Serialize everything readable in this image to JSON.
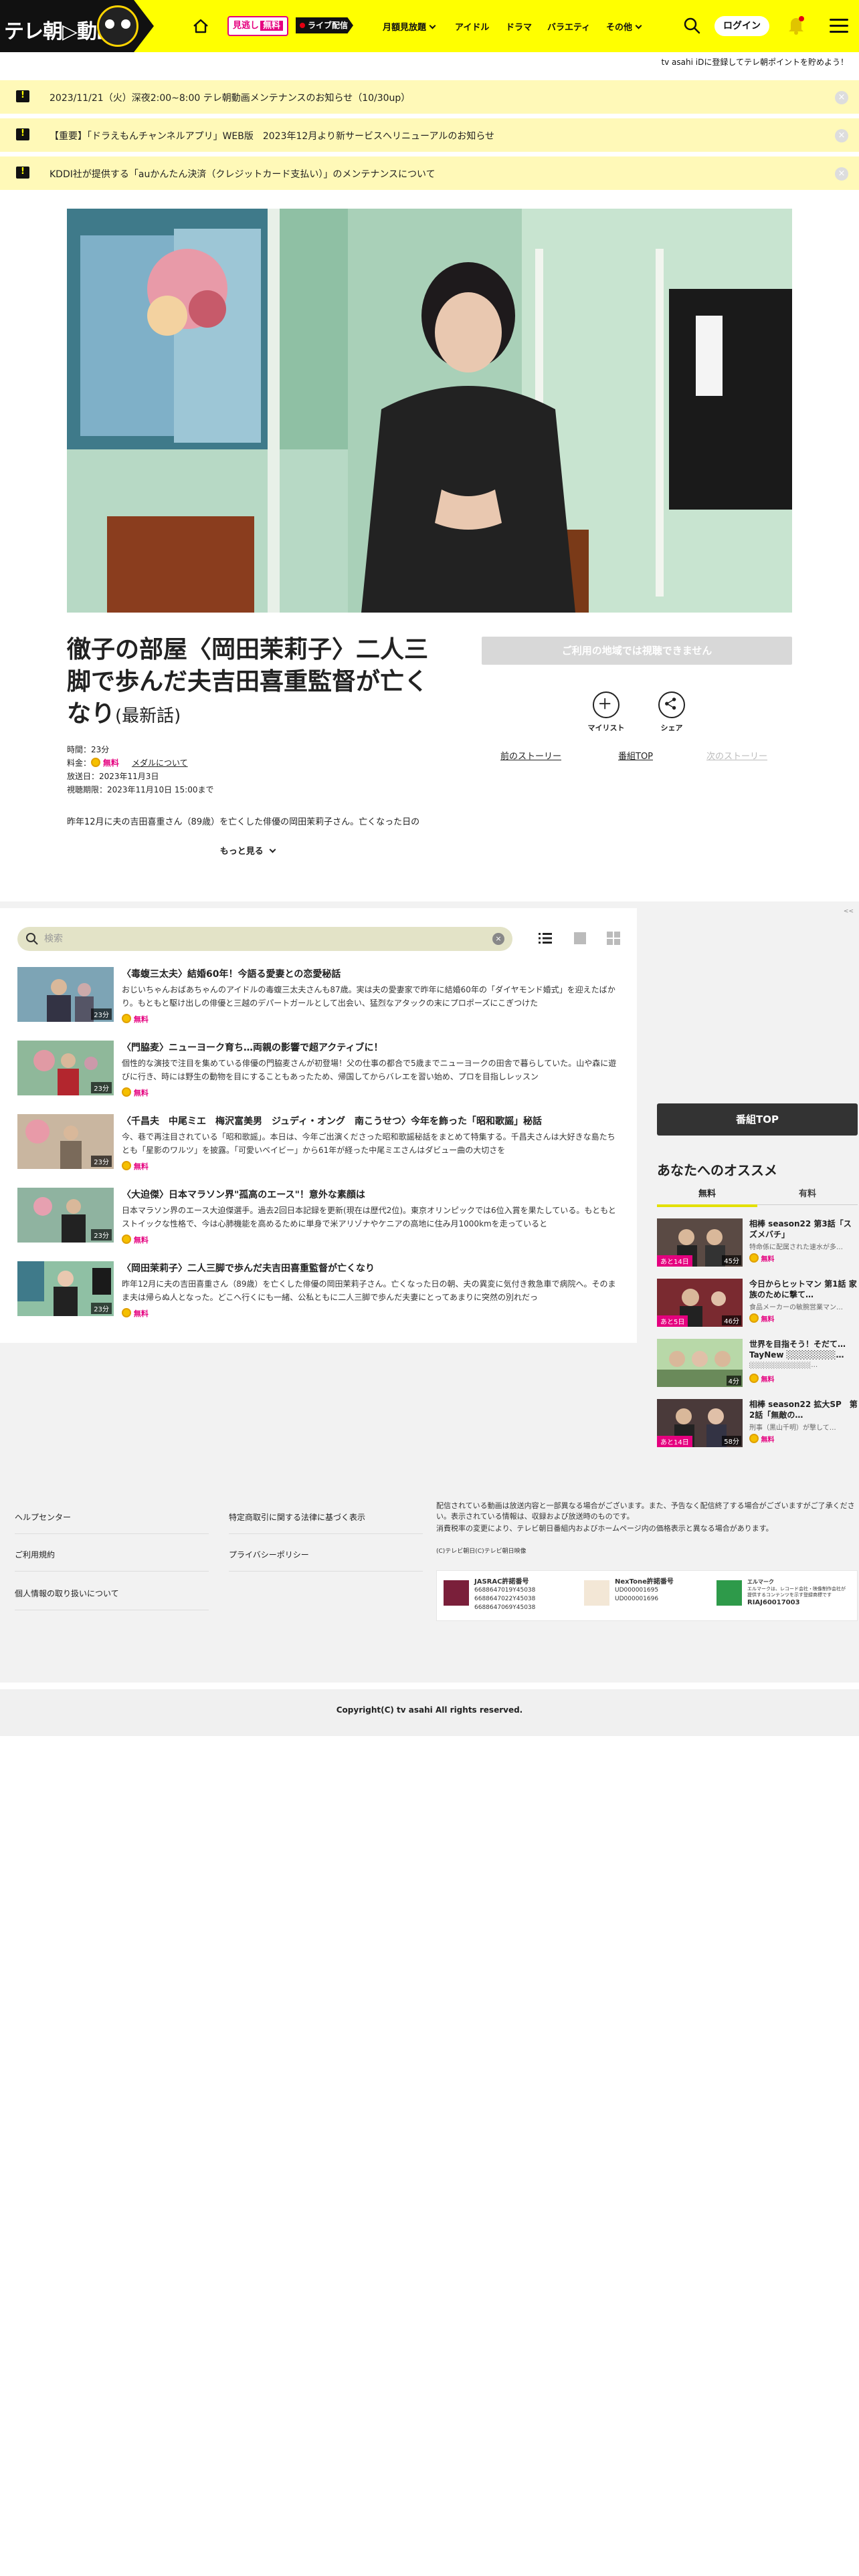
{
  "header": {
    "logo_text": "テレ朝▷動画",
    "promo_label": "見逃し",
    "promo_free": "無料",
    "live_label": "ライブ配信",
    "nav": [
      "月額見放題",
      "アイドル",
      "ドラマ",
      "バラエティ",
      "その他"
    ],
    "login_label": "ログイン",
    "accent_color": "#ffff00"
  },
  "subbar_text": "tv asahi iDに登録してテレ朝ポイントを貯めよう！",
  "notices": [
    "2023/11/21（火）深夜2:00~8:00 テレ朝動画メンテナンスのお知らせ（10/30up）",
    "【重要】「ドラえもんチャンネルアプリ」WEB版　2023年12月より新サービスへリニューアルのお知らせ",
    "KDDI社が提供する「auかんたん決済（クレジットカード支払い）」のメンテナンスについて"
  ],
  "episode": {
    "title": "徹子の部屋〈岡田茉莉子〉二人三脚で歩んだ夫吉田喜重監督が亡くなり",
    "title_suffix": "(最新話)",
    "duration": "時間：23分",
    "price_label": "料金：",
    "price_free": "無料",
    "medal_link": "メダルについて",
    "broadcast_date": "放送日：2023年11月3日",
    "available_until": "視聴期限：2023年11月10日 15:00まで",
    "description": "昨年12月に夫の吉田喜重さん（89歳）を亡くした俳優の岡田茉莉子さん。亡くなった日の",
    "more_label": "もっと見る",
    "unavailable_label": "ご利用の地域では視聴できません",
    "mylist_label": "マイリスト",
    "share_label": "シェア",
    "prev_story": "前のストーリー",
    "program_top": "番組TOP",
    "next_story": "次のストーリー"
  },
  "list": {
    "search_placeholder": "検索",
    "clear_label": "×",
    "items": [
      {
        "title": "〈毒蝮三太夫〉結婚60年！今語る愛妻との恋愛秘話",
        "summary": "おじいちゃんおばあちゃんのアイドルの毒蝮三太夫さんも87歳。実は夫の愛妻家で昨年に結婚60年の「ダイヤモンド婚式」を迎えたばかり。もともと駆け出しの俳優と三越のデパートガールとして出会い、猛烈なアタックの末にプロポーズにこぎつけた",
        "duration": "23分",
        "free": "無料"
      },
      {
        "title": "〈門脇麦〉ニューヨーク育ち…両親の影響で超アクティブに！",
        "summary": "個性的な演技で注目を集めている俳優の門脇麦さんが初登場！父の仕事の都合で5歳までニューヨークの田舎で暮らしていた。山や森に遊びに行き、時には野生の動物を目にすることもあったため、帰国してからバレエを習い始め、プロを目指しレッスン",
        "duration": "23分",
        "free": "無料"
      },
      {
        "title": "〈千昌夫　中尾ミエ　梅沢富美男　ジュディ・オング　南こうせつ〉今年を飾った「昭和歌謡」秘話",
        "summary": "今、巷で再注目されている「昭和歌謡」。本日は、今年ご出演くださった昭和歌謡秘話をまとめて特集する。千昌夫さんは大好きな島たちとも「星影のワルツ」を披露。「可愛いベイビー」から61年が経った中尾ミエさんはダビュー曲の大切さを",
        "duration": "23分",
        "free": "無料"
      },
      {
        "title": "〈大迫傑〉日本マラソン界\"孤高のエース\"！意外な素顔は",
        "summary": "日本マラソン界のエース大迫傑選手。過去2回日本記録を更新(現在は歴代2位)。東京オリンピックでは6位入賞を果たしている。もともとストイックな性格で、今は心肺機能を高めるために単身で米アリゾナやケニアの高地に住み月1000kmを走っていると",
        "duration": "23分",
        "free": "無料"
      },
      {
        "title": "〈岡田茉莉子〉二人三脚で歩んだ夫吉田喜重監督が亡くなり",
        "summary": "昨年12月に夫の吉田喜重さん（89歳）を亡くした俳優の岡田茉莉子さん。亡くなった日の朝、夫の異変に気付き救急車で病院へ。そのまま夫は帰らぬ人となった。どこへ行くにも一緒、公私ともに二人三脚で歩んだ夫妻にとってあまりに突然の別れだっ",
        "duration": "23分",
        "free": "無料"
      }
    ]
  },
  "sidebar": {
    "toggle_label": "<<",
    "program_top_label": "番組TOP",
    "heading": "あなたへのオススメ",
    "tabs": [
      "無料",
      "有料"
    ],
    "items": [
      {
        "title": "相棒 season22 第3話「スズメバチ」",
        "sub": "特命係に配属された速水が多…",
        "badge": "あと14日",
        "duration": "45分",
        "free": "無料"
      },
      {
        "title": "今日からヒットマン 第1話 家族のために撃て…",
        "sub": "食品メーカーの敏腕営業マン…",
        "badge": "あと5日",
        "duration": "46分",
        "free": "無料"
      },
      {
        "title": "世界を目指そう！そだて…TayNew ░░░░░░░░…",
        "sub": "░░░░░░░░░░░░…",
        "badge": "",
        "duration": "4分",
        "free": "無料"
      },
      {
        "title": "相棒 season22 拡大SP　第2話「無敵の…",
        "sub": "刑事（黒山千明）が撃して…",
        "badge": "あと14日",
        "duration": "58分",
        "free": "無料"
      }
    ]
  },
  "footer": {
    "links_left": [
      "ヘルプセンター",
      "ご利用規約",
      "個人情報の取り扱いについて"
    ],
    "links_mid": [
      "特定商取引に関する法律に基づく表示",
      "プライバシーポリシー"
    ],
    "note1": "配信されている動画は放送内容と一部異なる場合がございます。また、予告なく配信終了する場合がございますがご了承ください。表示されている情報は、収録および放送時のものです。",
    "note2": "消費税率の変更により、テレビ朝日番組内およびホームページ内の価格表示と異なる場合があります。",
    "copyright_small": "(C)テレビ朝日(C)テレビ朝日映像",
    "licenses": [
      {
        "name": "JASRAC許諾番号",
        "lines": [
          "6688647019Y45038",
          "6688647022Y45038",
          "6688647069Y45038"
        ]
      },
      {
        "name": "NexTone許諾番号",
        "lines": [
          "UD000001695",
          "UD000001696"
        ]
      },
      {
        "name": "エルマーク",
        "lines": [
          "エルマークは、レコード会社・映像制作会社が提供するコンテンツを示す登録商標です",
          "RIAJ60017003"
        ]
      }
    ],
    "copyright": "Copyright(C) tv asahi All rights reserved."
  }
}
